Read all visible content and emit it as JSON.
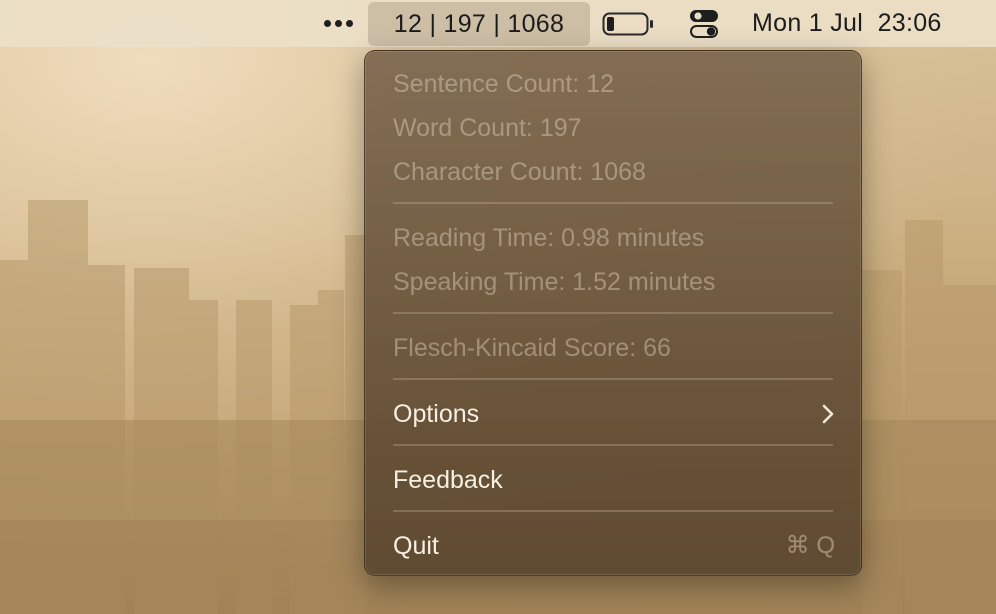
{
  "menubar": {
    "more_icon": "ellipsis-icon",
    "counts_label": "12 | 197 | 1068",
    "battery_icon": "battery-icon",
    "control_center_icon": "control-center-icon",
    "clock": "Mon 1 Jul  23:06"
  },
  "menu": {
    "stats": [
      "Sentence Count: 12",
      "Word Count: 197",
      "Character Count: 1068"
    ],
    "times": [
      "Reading Time: 0.98 minutes",
      "Speaking Time: 1.52 minutes"
    ],
    "score": "Flesch-Kincaid Score: 66",
    "options_label": "Options",
    "feedback_label": "Feedback",
    "quit_label": "Quit",
    "quit_shortcut": "⌘ Q"
  }
}
